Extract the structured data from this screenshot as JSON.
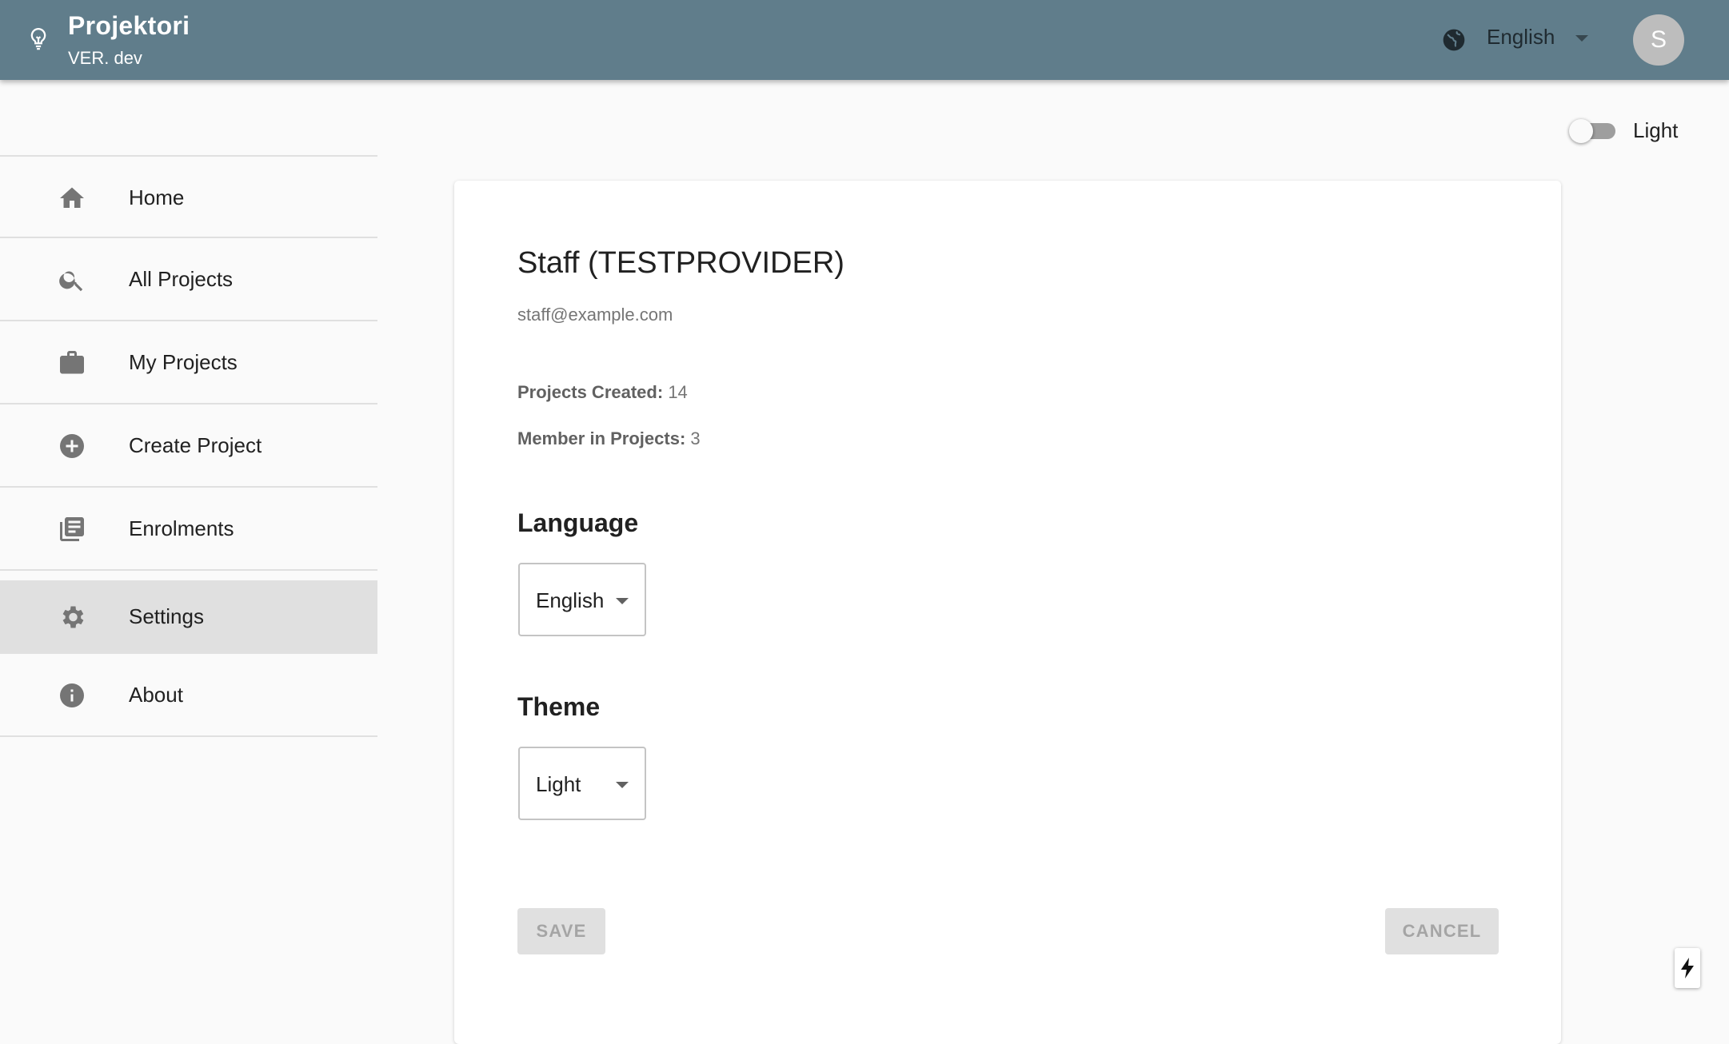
{
  "app": {
    "title": "Projektori",
    "version": "VER. dev",
    "logo_icon": "lightbulb-icon"
  },
  "header": {
    "language": "English",
    "avatar_initial": "S"
  },
  "theme_toggle": {
    "label": "Light",
    "checked": false
  },
  "sidebar": {
    "items": [
      {
        "label": "Home",
        "icon": "home-icon",
        "active": false
      },
      {
        "label": "All Projects",
        "icon": "search-icon",
        "active": false
      },
      {
        "label": "My Projects",
        "icon": "briefcase-icon",
        "active": false
      },
      {
        "label": "Create Project",
        "icon": "add-circle-icon",
        "active": false
      },
      {
        "label": "Enrolments",
        "icon": "library-books-icon",
        "active": false
      },
      {
        "label": "Settings",
        "icon": "gear-icon",
        "active": true
      },
      {
        "label": "About",
        "icon": "info-icon",
        "active": false
      }
    ]
  },
  "profile": {
    "name": "Staff (TESTPROVIDER)",
    "email": "staff@example.com",
    "projects_created_label": "Projects Created:",
    "projects_created": "14",
    "member_in_projects_label": "Member in Projects:",
    "member_in_projects": "3"
  },
  "settings": {
    "language_heading": "Language",
    "language_value": "English",
    "theme_heading": "Theme",
    "theme_value": "Light",
    "save_label": "SAVE",
    "cancel_label": "CANCEL"
  },
  "colors": {
    "appbar": "#607d8b",
    "active_nav": "#e0e0e0",
    "button_disabled": "#e0e0e0"
  }
}
